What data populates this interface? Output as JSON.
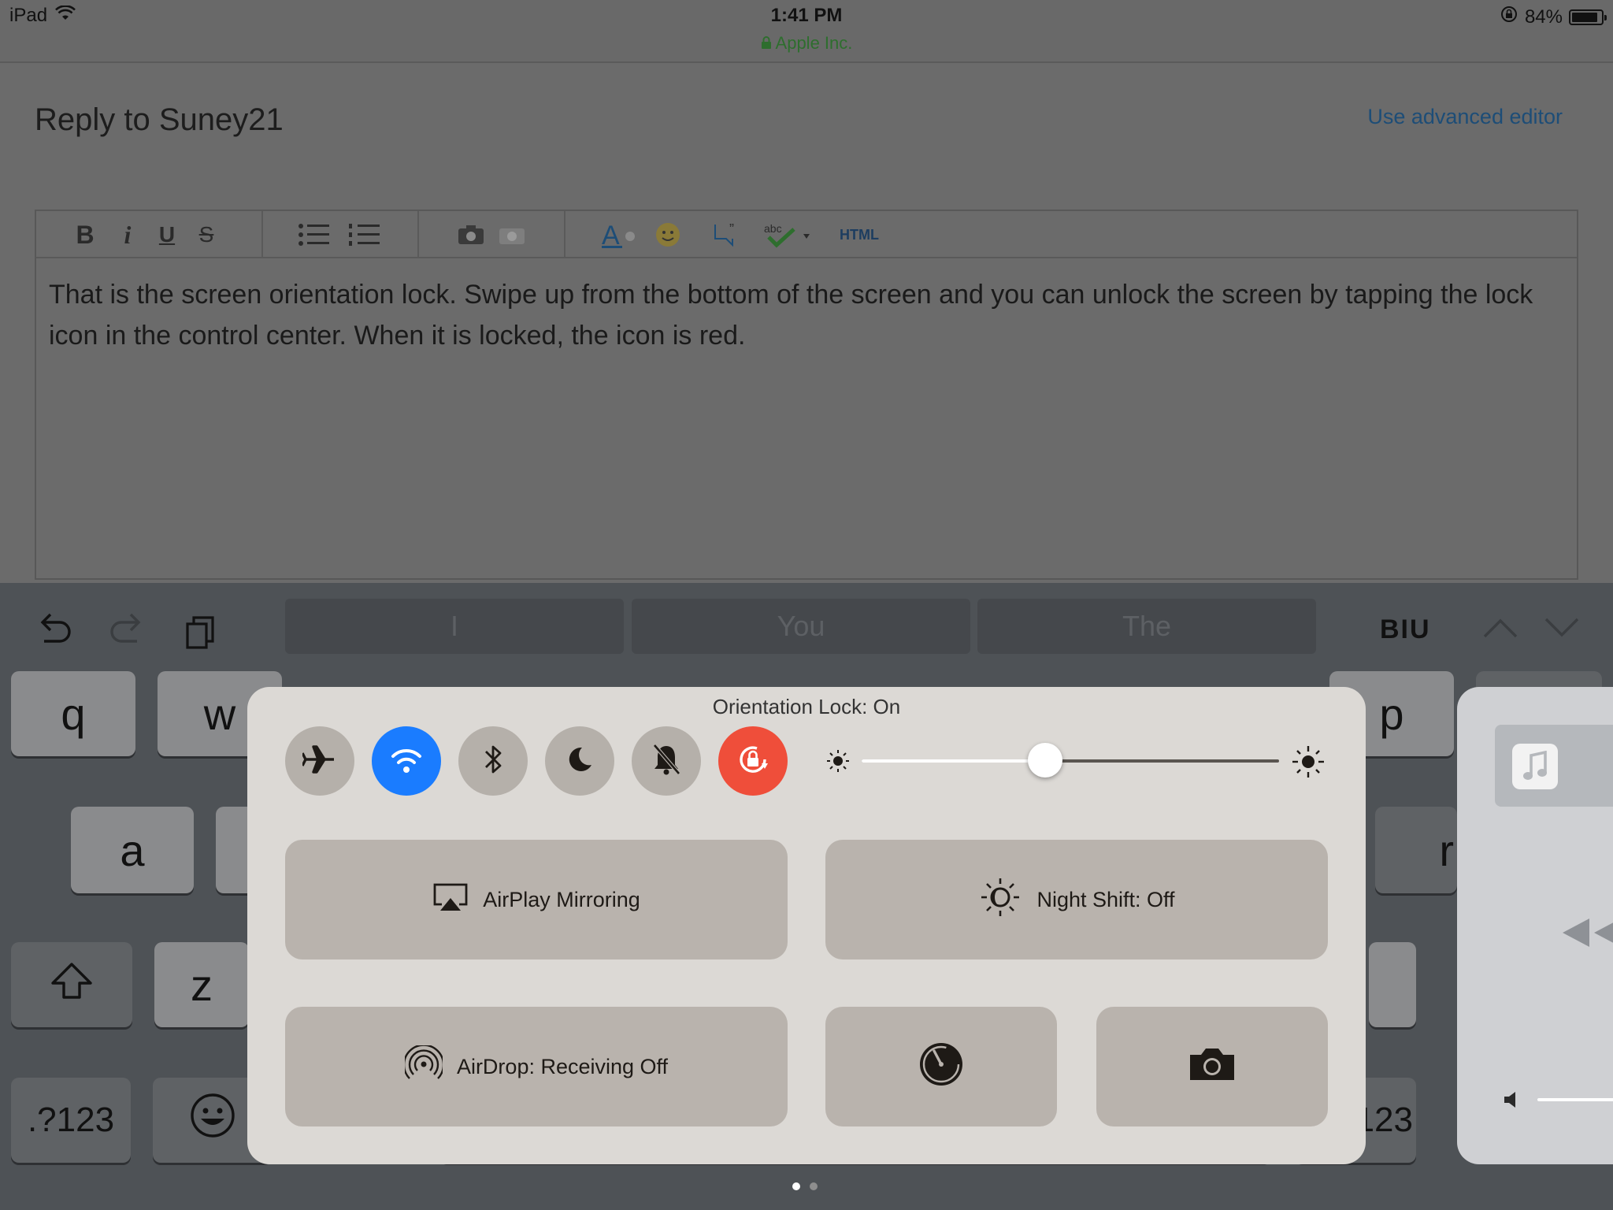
{
  "status_bar": {
    "device": "iPad",
    "time": "1:41 PM",
    "site": "Apple Inc.",
    "battery": "84%"
  },
  "page": {
    "title": "Reply to Suney21",
    "advanced_link": "Use advanced editor"
  },
  "editor": {
    "toolbar": {
      "bold": "B",
      "italic": "i",
      "underline": "U",
      "strike": "S",
      "html": "HTML"
    },
    "body_text": "That is the screen orientation lock. Swipe up from the bottom of the screen and you can unlock the screen by tapping the lock icon in the control center. When it is locked, the icon is red."
  },
  "keyboard": {
    "suggestions": [
      "I",
      "You",
      "The"
    ],
    "format_label": "BIU",
    "keys_visible": [
      "q",
      "w",
      "p",
      "a",
      "r",
      "z",
      ".?123",
      "123"
    ]
  },
  "control_center": {
    "title": "Orientation Lock: On",
    "toggles": [
      {
        "name": "airplane",
        "icon": "airplane-icon",
        "state": "off"
      },
      {
        "name": "wifi",
        "icon": "wifi-icon",
        "state": "on"
      },
      {
        "name": "bluetooth",
        "icon": "bluetooth-icon",
        "state": "off"
      },
      {
        "name": "do-not-disturb",
        "icon": "moon-icon",
        "state": "off"
      },
      {
        "name": "mute",
        "icon": "bell-slash-icon",
        "state": "off"
      },
      {
        "name": "orientation-lock",
        "icon": "rotation-lock-icon",
        "state": "on"
      }
    ],
    "brightness": 0.44,
    "tiles": {
      "airplay": "AirPlay Mirroring",
      "night_shift": "Night Shift: Off",
      "airdrop": "AirDrop: Receiving Off"
    },
    "colors": {
      "wifi_on": "#1a7cff",
      "lock_on": "#ef4e3a"
    }
  },
  "pager": {
    "pages": 2,
    "current": 1
  }
}
